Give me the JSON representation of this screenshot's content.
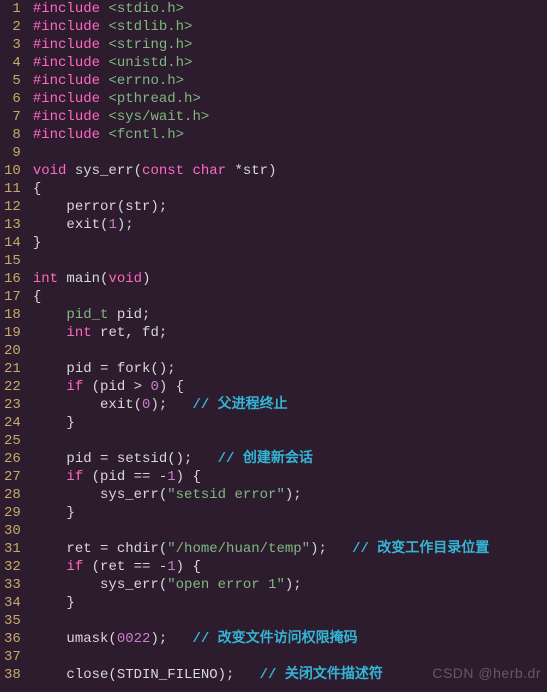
{
  "watermark": "CSDN @herb.dr",
  "lines": [
    {
      "n": 1,
      "tokens": [
        {
          "c": "tok-pp",
          "t": "#include "
        },
        {
          "c": "tok-hdr",
          "t": "<stdio.h>"
        }
      ]
    },
    {
      "n": 2,
      "tokens": [
        {
          "c": "tok-pp",
          "t": "#include "
        },
        {
          "c": "tok-hdr",
          "t": "<stdlib.h>"
        }
      ]
    },
    {
      "n": 3,
      "tokens": [
        {
          "c": "tok-pp",
          "t": "#include "
        },
        {
          "c": "tok-hdr",
          "t": "<string.h>"
        }
      ]
    },
    {
      "n": 4,
      "tokens": [
        {
          "c": "tok-pp",
          "t": "#include "
        },
        {
          "c": "tok-hdr",
          "t": "<unistd.h>"
        }
      ]
    },
    {
      "n": 5,
      "tokens": [
        {
          "c": "tok-pp",
          "t": "#include "
        },
        {
          "c": "tok-hdr",
          "t": "<errno.h>"
        }
      ]
    },
    {
      "n": 6,
      "tokens": [
        {
          "c": "tok-pp",
          "t": "#include "
        },
        {
          "c": "tok-hdr",
          "t": "<pthread.h>"
        }
      ]
    },
    {
      "n": 7,
      "tokens": [
        {
          "c": "tok-pp",
          "t": "#include "
        },
        {
          "c": "tok-hdr",
          "t": "<sys/wait.h>"
        }
      ]
    },
    {
      "n": 8,
      "tokens": [
        {
          "c": "tok-pp",
          "t": "#include "
        },
        {
          "c": "tok-hdr",
          "t": "<fcntl.h>"
        }
      ]
    },
    {
      "n": 9,
      "tokens": []
    },
    {
      "n": 10,
      "tokens": [
        {
          "c": "tok-kw",
          "t": "void"
        },
        {
          "c": "tok-id",
          "t": " sys_err("
        },
        {
          "c": "tok-kw",
          "t": "const char"
        },
        {
          "c": "tok-id",
          "t": " *str)"
        }
      ]
    },
    {
      "n": 11,
      "tokens": [
        {
          "c": "tok-punc",
          "t": "{"
        }
      ]
    },
    {
      "n": 12,
      "tokens": [
        {
          "c": "tok-id",
          "t": "    perror(str);"
        }
      ]
    },
    {
      "n": 13,
      "tokens": [
        {
          "c": "tok-id",
          "t": "    exit("
        },
        {
          "c": "tok-num",
          "t": "1"
        },
        {
          "c": "tok-id",
          "t": ");"
        }
      ]
    },
    {
      "n": 14,
      "tokens": [
        {
          "c": "tok-punc",
          "t": "}"
        }
      ]
    },
    {
      "n": 15,
      "tokens": []
    },
    {
      "n": 16,
      "tokens": [
        {
          "c": "tok-kw",
          "t": "int"
        },
        {
          "c": "tok-id",
          "t": " main("
        },
        {
          "c": "tok-kw",
          "t": "void"
        },
        {
          "c": "tok-id",
          "t": ")"
        }
      ]
    },
    {
      "n": 17,
      "tokens": [
        {
          "c": "tok-punc",
          "t": "{"
        }
      ]
    },
    {
      "n": 18,
      "tokens": [
        {
          "c": "tok-id",
          "t": "    "
        },
        {
          "c": "tok-type",
          "t": "pid_t"
        },
        {
          "c": "tok-id",
          "t": " pid;"
        }
      ]
    },
    {
      "n": 19,
      "tokens": [
        {
          "c": "tok-id",
          "t": "    "
        },
        {
          "c": "tok-kw",
          "t": "int"
        },
        {
          "c": "tok-id",
          "t": " ret, fd;"
        }
      ]
    },
    {
      "n": 20,
      "tokens": []
    },
    {
      "n": 21,
      "tokens": [
        {
          "c": "tok-id",
          "t": "    pid = fork();"
        }
      ]
    },
    {
      "n": 22,
      "tokens": [
        {
          "c": "tok-id",
          "t": "    "
        },
        {
          "c": "tok-kw",
          "t": "if"
        },
        {
          "c": "tok-id",
          "t": " (pid > "
        },
        {
          "c": "tok-num",
          "t": "0"
        },
        {
          "c": "tok-id",
          "t": ") {"
        }
      ]
    },
    {
      "n": 23,
      "tokens": [
        {
          "c": "tok-id",
          "t": "        exit("
        },
        {
          "c": "tok-num",
          "t": "0"
        },
        {
          "c": "tok-id",
          "t": ");   "
        },
        {
          "c": "tok-cmt",
          "t": "// 父进程终止"
        }
      ]
    },
    {
      "n": 24,
      "tokens": [
        {
          "c": "tok-id",
          "t": "    }"
        }
      ]
    },
    {
      "n": 25,
      "tokens": []
    },
    {
      "n": 26,
      "tokens": [
        {
          "c": "tok-id",
          "t": "    pid = setsid();   "
        },
        {
          "c": "tok-cmt",
          "t": "// 创建新会话"
        }
      ]
    },
    {
      "n": 27,
      "tokens": [
        {
          "c": "tok-id",
          "t": "    "
        },
        {
          "c": "tok-kw",
          "t": "if"
        },
        {
          "c": "tok-id",
          "t": " (pid == -"
        },
        {
          "c": "tok-num",
          "t": "1"
        },
        {
          "c": "tok-id",
          "t": ") {"
        }
      ]
    },
    {
      "n": 28,
      "tokens": [
        {
          "c": "tok-id",
          "t": "        sys_err("
        },
        {
          "c": "tok-str",
          "t": "\"setsid error\""
        },
        {
          "c": "tok-id",
          "t": ");"
        }
      ]
    },
    {
      "n": 29,
      "tokens": [
        {
          "c": "tok-id",
          "t": "    }"
        }
      ]
    },
    {
      "n": 30,
      "tokens": []
    },
    {
      "n": 31,
      "tokens": [
        {
          "c": "tok-id",
          "t": "    ret = chdir("
        },
        {
          "c": "tok-str",
          "t": "\"/home/huan/temp\""
        },
        {
          "c": "tok-id",
          "t": ");   "
        },
        {
          "c": "tok-cmt",
          "t": "// 改变工作目录位置"
        }
      ]
    },
    {
      "n": 32,
      "tokens": [
        {
          "c": "tok-id",
          "t": "    "
        },
        {
          "c": "tok-kw",
          "t": "if"
        },
        {
          "c": "tok-id",
          "t": " (ret == -"
        },
        {
          "c": "tok-num",
          "t": "1"
        },
        {
          "c": "tok-id",
          "t": ") {"
        }
      ]
    },
    {
      "n": 33,
      "tokens": [
        {
          "c": "tok-id",
          "t": "        sys_err("
        },
        {
          "c": "tok-str",
          "t": "\"open error 1\""
        },
        {
          "c": "tok-id",
          "t": ");"
        }
      ]
    },
    {
      "n": 34,
      "tokens": [
        {
          "c": "tok-id",
          "t": "    }"
        }
      ]
    },
    {
      "n": 35,
      "tokens": []
    },
    {
      "n": 36,
      "tokens": [
        {
          "c": "tok-id",
          "t": "    umask("
        },
        {
          "c": "tok-num",
          "t": "0022"
        },
        {
          "c": "tok-id",
          "t": ");   "
        },
        {
          "c": "tok-cmt",
          "t": "// 改变文件访问权限掩码"
        }
      ]
    },
    {
      "n": 37,
      "tokens": []
    },
    {
      "n": 38,
      "tokens": [
        {
          "c": "tok-id",
          "t": "    close(STDIN_FILENO);   "
        },
        {
          "c": "tok-cmt",
          "t": "// 关闭文件描述符"
        }
      ]
    }
  ]
}
